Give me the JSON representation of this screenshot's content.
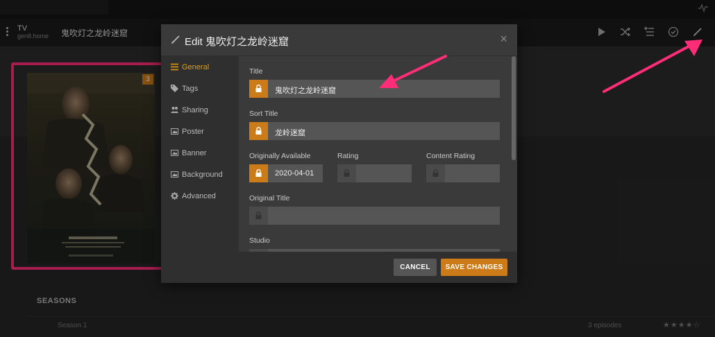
{
  "header": {
    "section_title": "TV",
    "server_name": "gen8.home",
    "show_title": "鬼吹灯之龙岭迷窟",
    "actions": [
      "play-icon",
      "shuffle-icon",
      "add-to-queue-icon",
      "mark-watched-icon",
      "edit-icon"
    ]
  },
  "poster": {
    "badge": "3"
  },
  "seasons": {
    "label": "SEASONS",
    "rows": [
      {
        "name": "Season 1",
        "episodes": "3 episodes",
        "stars": "★★★★☆"
      }
    ]
  },
  "modal": {
    "title": "Edit 鬼吹灯之龙岭迷窟",
    "close_glyph": "×",
    "nav": [
      {
        "label": "General",
        "icon": "list-icon",
        "active": true
      },
      {
        "label": "Tags",
        "icon": "tag-icon",
        "active": false
      },
      {
        "label": "Sharing",
        "icon": "users-icon",
        "active": false
      },
      {
        "label": "Poster",
        "icon": "image-icon",
        "active": false
      },
      {
        "label": "Banner",
        "icon": "image-icon",
        "active": false
      },
      {
        "label": "Background",
        "icon": "image-icon",
        "active": false
      },
      {
        "label": "Advanced",
        "icon": "gear-icon",
        "active": false
      }
    ],
    "fields": {
      "title": {
        "label": "Title",
        "value": "鬼吹灯之龙岭迷窟",
        "locked": true
      },
      "sort_title": {
        "label": "Sort Title",
        "value": "龙岭迷窟",
        "locked": true
      },
      "originally_available": {
        "label": "Originally Available",
        "value": "2020-04-01",
        "locked": true
      },
      "rating": {
        "label": "Rating",
        "value": "",
        "locked": false
      },
      "content_rating": {
        "label": "Content Rating",
        "value": "",
        "locked": false
      },
      "original_title": {
        "label": "Original Title",
        "value": "",
        "locked": false
      },
      "studio": {
        "label": "Studio",
        "value": "",
        "locked": false
      }
    },
    "buttons": {
      "cancel": "CANCEL",
      "save": "SAVE CHANGES"
    }
  },
  "colors": {
    "accent": "#cc7b19",
    "active_nav": "#e5a00d",
    "annotation": "#ff2d78"
  }
}
